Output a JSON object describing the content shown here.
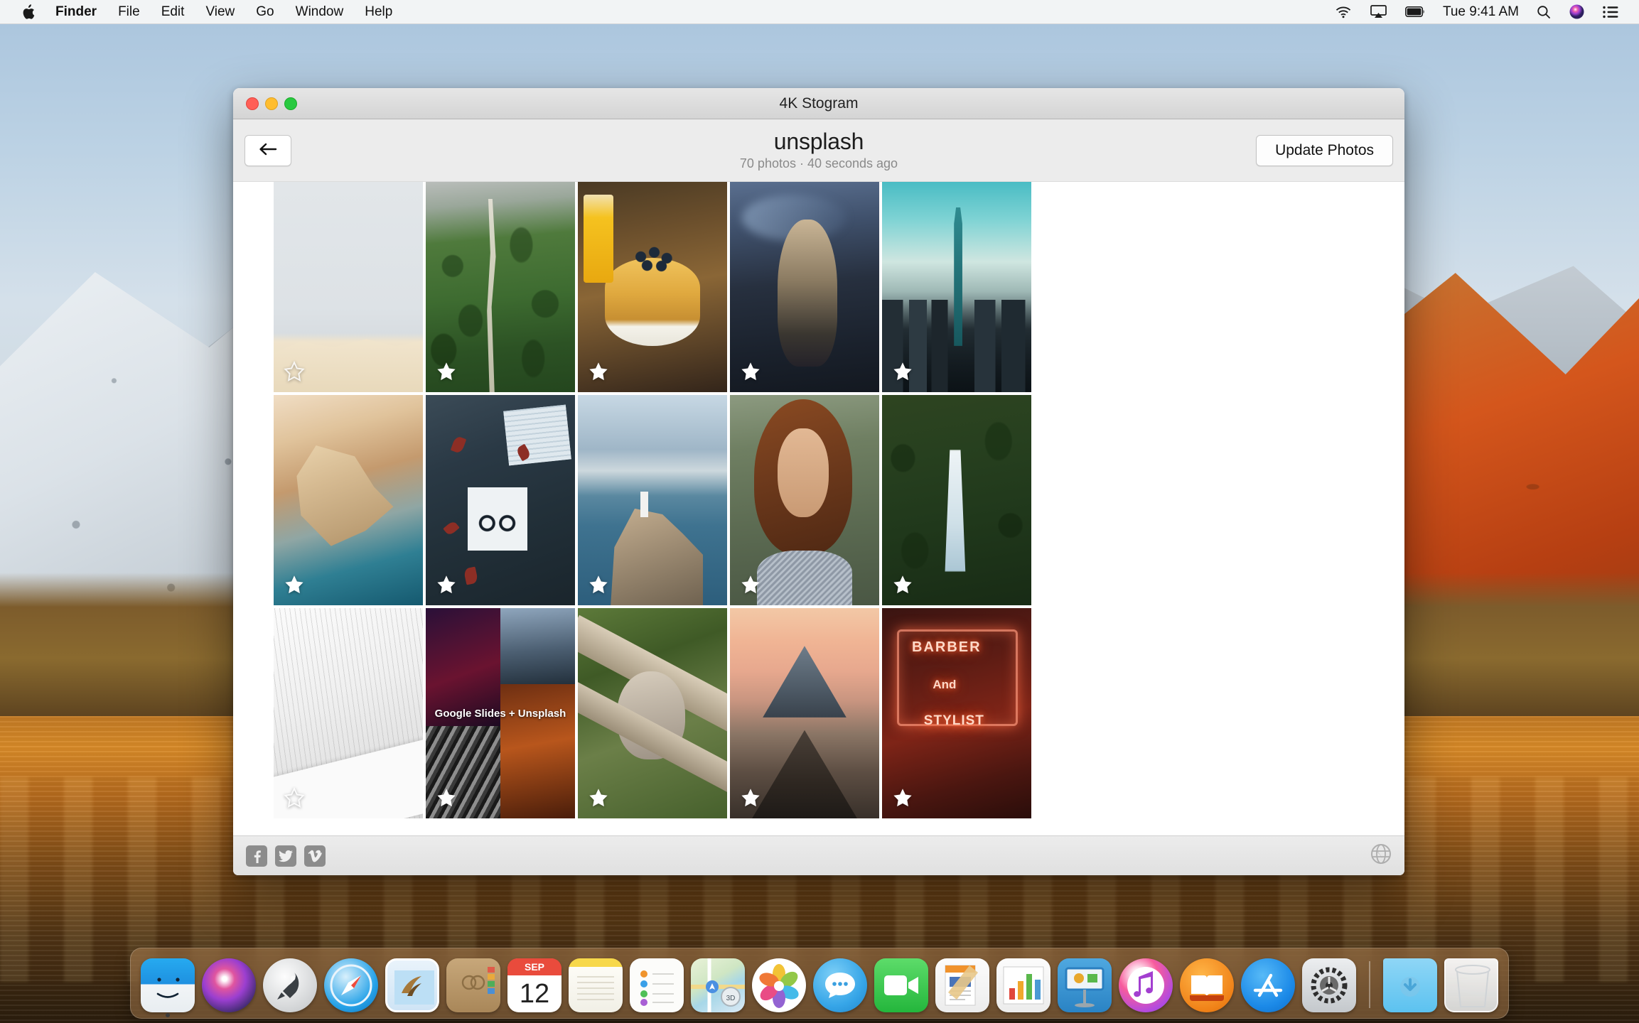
{
  "menubar": {
    "apple_icon": "apple-icon",
    "items": [
      {
        "label": "Finder",
        "bold": true
      },
      {
        "label": "File",
        "bold": false
      },
      {
        "label": "Edit",
        "bold": false
      },
      {
        "label": "View",
        "bold": false
      },
      {
        "label": "Go",
        "bold": false
      },
      {
        "label": "Window",
        "bold": false
      },
      {
        "label": "Help",
        "bold": false
      }
    ],
    "status": {
      "wifi_icon": "wifi-icon",
      "airplay_icon": "airplay-icon",
      "battery_icon": "battery-icon",
      "clock": "Tue 9:41 AM",
      "spotlight_icon": "search-icon",
      "siri_icon": "siri-icon",
      "control_center_icon": "list-icon"
    }
  },
  "window": {
    "title": "4K Stogram",
    "traffic_lights": [
      "close-button",
      "minimize-button",
      "zoom-button"
    ],
    "toolbar": {
      "back_icon": "arrow-left-icon",
      "account_name": "unsplash",
      "meta": "70 photos · 40 seconds ago",
      "update_label": "Update Photos"
    },
    "bottom": {
      "facebook_label": "f",
      "twitter_icon": "twitter-icon",
      "vimeo_label": "v",
      "globe_icon": "globe-icon"
    }
  },
  "grid": {
    "photos": [
      {
        "name": "desert-dune",
        "art": "p-dune",
        "starred": false,
        "caption": ""
      },
      {
        "name": "aerial-green-valley",
        "art": "p-valley",
        "starred": true,
        "caption": ""
      },
      {
        "name": "blueberry-pancakes",
        "art": "p-pancake",
        "starred": true,
        "caption": ""
      },
      {
        "name": "woman-with-phone-dusk",
        "art": "p-girl",
        "starred": true,
        "caption": ""
      },
      {
        "name": "taipei-city-skyline",
        "art": "p-city",
        "starred": true,
        "caption": ""
      },
      {
        "name": "aerial-coastline",
        "art": "p-coast",
        "starred": true,
        "caption": ""
      },
      {
        "name": "desk-flatlay-glasses",
        "art": "p-desk",
        "starred": true,
        "caption": ""
      },
      {
        "name": "lighthouse-cliff-sea",
        "art": "p-light",
        "starred": true,
        "caption": ""
      },
      {
        "name": "red-haired-woman-portrait",
        "art": "p-red",
        "starred": true,
        "caption": ""
      },
      {
        "name": "forest-waterfall",
        "art": "p-fall",
        "starred": true,
        "caption": ""
      },
      {
        "name": "white-architecture",
        "art": "p-arch",
        "starred": false,
        "caption": ""
      },
      {
        "name": "google-slides-collage",
        "art": "p-collage",
        "starred": true,
        "caption": "Google Slides + Unsplash"
      },
      {
        "name": "macaque-monkey-branch",
        "art": "p-monkey",
        "starred": true,
        "caption": ""
      },
      {
        "name": "volcano-sunrise",
        "art": "p-volcano",
        "starred": true,
        "caption": ""
      },
      {
        "name": "barber-neon-sign",
        "art": "p-barber",
        "starred": true,
        "caption": "BARBER"
      }
    ],
    "barber_lines": [
      "BARBER",
      "And",
      "STYLIST"
    ]
  },
  "dock": {
    "items": [
      {
        "name": "finder",
        "cls": "di-finder",
        "running": true
      },
      {
        "name": "siri",
        "cls": "di-siri",
        "running": false
      },
      {
        "name": "launchpad",
        "cls": "di-launch",
        "running": false
      },
      {
        "name": "safari",
        "cls": "di-safari",
        "running": false
      },
      {
        "name": "mail",
        "cls": "di-mail",
        "running": false
      },
      {
        "name": "contacts",
        "cls": "di-contacts",
        "running": false
      },
      {
        "name": "calendar",
        "cls": "di-calendar",
        "running": false
      },
      {
        "name": "notes",
        "cls": "di-notes",
        "running": false
      },
      {
        "name": "reminders",
        "cls": "di-reminders",
        "running": false
      },
      {
        "name": "maps",
        "cls": "di-maps",
        "running": false
      },
      {
        "name": "photos",
        "cls": "di-photos",
        "running": false
      },
      {
        "name": "messages",
        "cls": "di-messages",
        "running": false
      },
      {
        "name": "facetime",
        "cls": "di-facetime",
        "running": false
      },
      {
        "name": "pages",
        "cls": "di-pages",
        "running": false
      },
      {
        "name": "numbers",
        "cls": "di-numbers",
        "running": false
      },
      {
        "name": "keynote",
        "cls": "di-keynote",
        "running": false
      },
      {
        "name": "itunes",
        "cls": "di-itunes",
        "running": false
      },
      {
        "name": "ibooks",
        "cls": "di-ibooks",
        "running": false
      },
      {
        "name": "app-store",
        "cls": "di-appstore",
        "running": false
      },
      {
        "name": "system-preferences",
        "cls": "di-syspref",
        "running": false
      },
      {
        "name": "separator",
        "cls": "sep",
        "running": false
      },
      {
        "name": "downloads-folder",
        "cls": "di-downloads",
        "running": false
      },
      {
        "name": "trash",
        "cls": "di-trash",
        "running": false
      }
    ],
    "calendar_month": "SEP",
    "calendar_day": "12"
  },
  "colors": {
    "accent": "#1d1d1d",
    "meta_gray": "#8a8a8a",
    "window_chrome": "#ececec",
    "social_gray": "#8c8c8c"
  }
}
